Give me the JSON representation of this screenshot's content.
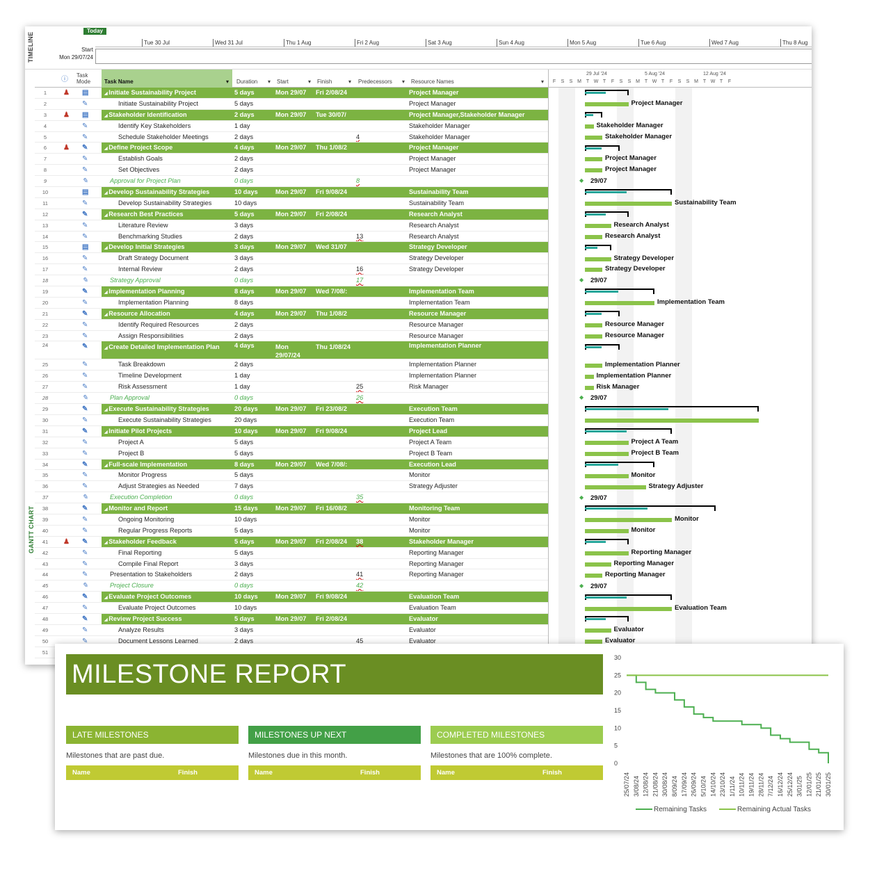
{
  "timeline": {
    "side_label": "TIMELINE",
    "today_label": "Today",
    "start_label": "Start",
    "start_date": "Mon 29/07/24",
    "ticks": [
      "Tue 30 Jul",
      "Wed 31 Jul",
      "Thu 1 Aug",
      "Fri 2 Aug",
      "Sat 3 Aug",
      "Sun 4 Aug",
      "Mon 5 Aug",
      "Tue 6 Aug",
      "Wed 7 Aug",
      "Thu 8 Aug"
    ]
  },
  "gantt": {
    "side_label": "GANTT CHART",
    "columns": {
      "task_mode": "Task Mode",
      "task_name": "Task Name",
      "duration": "Duration",
      "start": "Start",
      "finish": "Finish",
      "predecessors": "Predecessors",
      "resources": "Resource Names"
    },
    "chart_header": {
      "weeks": [
        "29 Jul '24",
        "5 Aug '24",
        "12 Aug '24"
      ],
      "days": [
        "F",
        "S",
        "S",
        "M",
        "T",
        "W",
        "T",
        "F",
        "S",
        "S",
        "M",
        "T",
        "W",
        "T",
        "F",
        "S",
        "S",
        "M",
        "T",
        "W",
        "T",
        "F"
      ]
    },
    "rows": [
      {
        "id": "1",
        "name": "Initiate Sustainability Project",
        "dur": "5 days",
        "start": "Mon 29/07",
        "finish": "Fri 2/08/24",
        "pred": "",
        "res": "Project Manager",
        "type": "sum",
        "person": true,
        "mode": "auto"
      },
      {
        "id": "2",
        "name": "Initiate Sustainability Project",
        "dur": "5 days",
        "start": "",
        "finish": "",
        "pred": "",
        "res": "Project Manager",
        "type": "task"
      },
      {
        "id": "3",
        "name": "Stakeholder Identification",
        "dur": "2 days",
        "start": "Mon 29/07",
        "finish": "Tue 30/07/",
        "pred": "",
        "res": "Project Manager,Stakeholder Manager",
        "type": "sum",
        "person": true,
        "mode": "auto"
      },
      {
        "id": "4",
        "name": "Identify Key Stakeholders",
        "dur": "1 day",
        "start": "",
        "finish": "",
        "pred": "",
        "res": "Stakeholder Manager",
        "type": "task"
      },
      {
        "id": "5",
        "name": "Schedule Stakeholder Meetings",
        "dur": "2 days",
        "start": "",
        "finish": "",
        "pred": "4",
        "res": "Stakeholder Manager",
        "type": "task"
      },
      {
        "id": "6",
        "name": "Define Project Scope",
        "dur": "4 days",
        "start": "Mon 29/07",
        "finish": "Thu 1/08/2",
        "pred": "",
        "res": "Project Manager",
        "type": "sum",
        "person": true
      },
      {
        "id": "7",
        "name": "Establish Goals",
        "dur": "2 days",
        "start": "",
        "finish": "",
        "pred": "",
        "res": "Project Manager",
        "type": "task"
      },
      {
        "id": "8",
        "name": "Set Objectives",
        "dur": "2 days",
        "start": "",
        "finish": "",
        "pred": "",
        "res": "Project Manager",
        "type": "task"
      },
      {
        "id": "9",
        "name": "Approval for Project Plan",
        "dur": "0 days",
        "start": "",
        "finish": "",
        "pred": "8",
        "res": "",
        "type": "ms"
      },
      {
        "id": "10",
        "name": "Develop Sustainability Strategies",
        "dur": "10 days",
        "start": "Mon 29/07",
        "finish": "Fri 9/08/24",
        "pred": "",
        "res": "Sustainability Team",
        "type": "sum",
        "mode": "auto"
      },
      {
        "id": "11",
        "name": "Develop Sustainability Strategies",
        "dur": "10 days",
        "start": "",
        "finish": "",
        "pred": "",
        "res": "Sustainability Team",
        "type": "task"
      },
      {
        "id": "12",
        "name": "Research Best Practices",
        "dur": "5 days",
        "start": "Mon 29/07",
        "finish": "Fri 2/08/24",
        "pred": "",
        "res": "Research Analyst",
        "type": "sum"
      },
      {
        "id": "13",
        "name": "Literature Review",
        "dur": "3 days",
        "start": "",
        "finish": "",
        "pred": "",
        "res": "Research Analyst",
        "type": "task"
      },
      {
        "id": "14",
        "name": "Benchmarking Studies",
        "dur": "2 days",
        "start": "",
        "finish": "",
        "pred": "13",
        "res": "Research Analyst",
        "type": "task"
      },
      {
        "id": "15",
        "name": "Develop Initial Strategies",
        "dur": "3 days",
        "start": "Mon 29/07",
        "finish": "Wed 31/07",
        "pred": "",
        "res": "Strategy Developer",
        "type": "sum",
        "mode": "auto"
      },
      {
        "id": "16",
        "name": "Draft Strategy Document",
        "dur": "3 days",
        "start": "",
        "finish": "",
        "pred": "",
        "res": "Strategy Developer",
        "type": "task"
      },
      {
        "id": "17",
        "name": "Internal Review",
        "dur": "2 days",
        "start": "",
        "finish": "",
        "pred": "16",
        "res": "Strategy Developer",
        "type": "task"
      },
      {
        "id": "18",
        "name": "Strategy Approval",
        "dur": "0 days",
        "start": "",
        "finish": "",
        "pred": "17",
        "res": "",
        "type": "ms"
      },
      {
        "id": "19",
        "name": "Implementation Planning",
        "dur": "8 days",
        "start": "Mon 29/07",
        "finish": "Wed 7/08/:",
        "pred": "",
        "res": "Implementation Team",
        "type": "sum"
      },
      {
        "id": "20",
        "name": "Implementation Planning",
        "dur": "8 days",
        "start": "",
        "finish": "",
        "pred": "",
        "res": "Implementation Team",
        "type": "task"
      },
      {
        "id": "21",
        "name": "Resource Allocation",
        "dur": "4 days",
        "start": "Mon 29/07",
        "finish": "Thu 1/08/2",
        "pred": "",
        "res": "Resource Manager",
        "type": "sum"
      },
      {
        "id": "22",
        "name": "Identify Required Resources",
        "dur": "2 days",
        "start": "",
        "finish": "",
        "pred": "",
        "res": "Resource Manager",
        "type": "task"
      },
      {
        "id": "23",
        "name": "Assign Responsibilities",
        "dur": "2 days",
        "start": "",
        "finish": "",
        "pred": "",
        "res": "Resource Manager",
        "type": "task"
      },
      {
        "id": "24",
        "name": "Create Detailed Implementation Plan",
        "dur": "4 days",
        "start": "Mon 29/07/24",
        "finish": "Thu 1/08/24",
        "pred": "",
        "res": "Implementation Planner",
        "type": "sum",
        "tall": true
      },
      {
        "id": "25",
        "name": "Task Breakdown",
        "dur": "2 days",
        "start": "",
        "finish": "",
        "pred": "",
        "res": "Implementation Planner",
        "type": "task"
      },
      {
        "id": "26",
        "name": "Timeline Development",
        "dur": "1 day",
        "start": "",
        "finish": "",
        "pred": "",
        "res": "Implementation Planner",
        "type": "task"
      },
      {
        "id": "27",
        "name": "Risk Assessment",
        "dur": "1 day",
        "start": "",
        "finish": "",
        "pred": "25",
        "res": "Risk Manager",
        "type": "task"
      },
      {
        "id": "28",
        "name": "Plan Approval",
        "dur": "0 days",
        "start": "",
        "finish": "",
        "pred": "26",
        "res": "",
        "type": "ms"
      },
      {
        "id": "29",
        "name": "Execute Sustainability Strategies",
        "dur": "20 days",
        "start": "Mon 29/07",
        "finish": "Fri 23/08/2",
        "pred": "",
        "res": "Execution Team",
        "type": "sum"
      },
      {
        "id": "30",
        "name": "Execute Sustainability Strategies",
        "dur": "20 days",
        "start": "",
        "finish": "",
        "pred": "",
        "res": "Execution Team",
        "type": "task"
      },
      {
        "id": "31",
        "name": "Initiate Pilot Projects",
        "dur": "10 days",
        "start": "Mon 29/07",
        "finish": "Fri 9/08/24",
        "pred": "",
        "res": "Project Lead",
        "type": "sum"
      },
      {
        "id": "32",
        "name": "Project A",
        "dur": "5 days",
        "start": "",
        "finish": "",
        "pred": "",
        "res": "Project A Team",
        "type": "task"
      },
      {
        "id": "33",
        "name": "Project B",
        "dur": "5 days",
        "start": "",
        "finish": "",
        "pred": "",
        "res": "Project B Team",
        "type": "task"
      },
      {
        "id": "34",
        "name": "Full-scale Implementation",
        "dur": "8 days",
        "start": "Mon 29/07",
        "finish": "Wed 7/08/:",
        "pred": "",
        "res": "Execution Lead",
        "type": "sum"
      },
      {
        "id": "35",
        "name": "Monitor Progress",
        "dur": "5 days",
        "start": "",
        "finish": "",
        "pred": "",
        "res": "Monitor",
        "type": "task"
      },
      {
        "id": "36",
        "name": "Adjust Strategies as Needed",
        "dur": "7 days",
        "start": "",
        "finish": "",
        "pred": "",
        "res": "Strategy Adjuster",
        "type": "task"
      },
      {
        "id": "37",
        "name": "Execution Completion",
        "dur": "0 days",
        "start": "",
        "finish": "",
        "pred": "35",
        "res": "",
        "type": "ms"
      },
      {
        "id": "38",
        "name": "Monitor and Report",
        "dur": "15 days",
        "start": "Mon 29/07",
        "finish": "Fri 16/08/2",
        "pred": "",
        "res": "Monitoring Team",
        "type": "sum"
      },
      {
        "id": "39",
        "name": "Ongoing Monitoring",
        "dur": "10 days",
        "start": "",
        "finish": "",
        "pred": "",
        "res": "Monitor",
        "type": "task"
      },
      {
        "id": "40",
        "name": "Regular Progress Reports",
        "dur": "5 days",
        "start": "",
        "finish": "",
        "pred": "",
        "res": "Monitor",
        "type": "task"
      },
      {
        "id": "41",
        "name": "Stakeholder Feedback",
        "dur": "5 days",
        "start": "Mon 29/07",
        "finish": "Fri 2/08/24",
        "pred": "38",
        "res": "Stakeholder Manager",
        "type": "sum",
        "person": true
      },
      {
        "id": "42",
        "name": "Final Reporting",
        "dur": "5 days",
        "start": "",
        "finish": "",
        "pred": "",
        "res": "Reporting Manager",
        "type": "task"
      },
      {
        "id": "43",
        "name": "Compile Final Report",
        "dur": "3 days",
        "start": "",
        "finish": "",
        "pred": "",
        "res": "Reporting Manager",
        "type": "task"
      },
      {
        "id": "44",
        "name": "Presentation to Stakeholders",
        "dur": "2 days",
        "start": "",
        "finish": "",
        "pred": "41",
        "res": "Reporting Manager",
        "type": "task0"
      },
      {
        "id": "45",
        "name": "Project Closure",
        "dur": "0 days",
        "start": "",
        "finish": "",
        "pred": "42",
        "res": "",
        "type": "ms"
      },
      {
        "id": "46",
        "name": "Evaluate Project Outcomes",
        "dur": "10 days",
        "start": "Mon 29/07",
        "finish": "Fri 9/08/24",
        "pred": "",
        "res": "Evaluation Team",
        "type": "sum"
      },
      {
        "id": "47",
        "name": "Evaluate Project Outcomes",
        "dur": "10 days",
        "start": "",
        "finish": "",
        "pred": "",
        "res": "Evaluation Team",
        "type": "task"
      },
      {
        "id": "48",
        "name": "Review Project Success",
        "dur": "5 days",
        "start": "Mon 29/07",
        "finish": "Fri 2/08/24",
        "pred": "",
        "res": "Evaluator",
        "type": "sum"
      },
      {
        "id": "49",
        "name": "Analyze Results",
        "dur": "3 days",
        "start": "",
        "finish": "",
        "pred": "",
        "res": "Evaluator",
        "type": "task"
      },
      {
        "id": "50",
        "name": "Document Lessons Learned",
        "dur": "2 days",
        "start": "",
        "finish": "",
        "pred": "45",
        "res": "Evaluator",
        "type": "task"
      },
      {
        "id": "51",
        "name": "",
        "dur": "",
        "start": "",
        "finish": "",
        "pred": "",
        "res": "",
        "type": "empty"
      }
    ],
    "bar_labels": {
      "2": "Project Manager",
      "4": "Stakeholder Manager",
      "5": "Stakeholder Manager",
      "7": "Project Manager",
      "8": "Project Manager",
      "9": "29/07",
      "11": "Sustainability Team",
      "13": "Research Analyst",
      "14": "Research Analyst",
      "16": "Strategy Developer",
      "17": "Strategy Developer",
      "18": "29/07",
      "20": "Implementation Team",
      "22": "Resource Manager",
      "23": "Resource Manager",
      "25": "Implementation Planner",
      "26": "Implementation Planner",
      "27": "Risk Manager",
      "28": "29/07",
      "32": "Project A Team",
      "33": "Project B Team",
      "35": "Monitor",
      "36": "Strategy Adjuster",
      "37": "29/07",
      "39": "Monitor",
      "40": "Monitor",
      "42": "Reporting Manager",
      "43": "Reporting Manager",
      "44": "Reporting Manager",
      "45": "29/07",
      "47": "Evaluation Team",
      "49": "Evaluator",
      "50": "Evaluator"
    }
  },
  "report": {
    "title": "MILESTONE REPORT",
    "sections": [
      {
        "heading": "LATE MILESTONES",
        "desc": "Milestones that are past due.",
        "col1": "Name",
        "col2": "Finish",
        "color": "#8bb432"
      },
      {
        "heading": "MILESTONES UP NEXT",
        "desc": "Milestones due in this month.",
        "col1": "Name",
        "col2": "Finish",
        "color": "#43a047"
      },
      {
        "heading": "COMPLETED MILESTONES",
        "desc": "Milestones that are 100% complete.",
        "col1": "Name",
        "col2": "Finish",
        "color": "#9ccc50"
      }
    ]
  },
  "chart_data": {
    "type": "line",
    "title": "",
    "xlabel": "",
    "ylabel": "",
    "ylim": [
      0,
      30
    ],
    "yticks": [
      0,
      5,
      10,
      15,
      20,
      25,
      30
    ],
    "categories": [
      "25/07/24",
      "3/08/24",
      "12/08/24",
      "21/08/24",
      "30/08/24",
      "8/09/24",
      "17/09/24",
      "26/09/24",
      "5/10/24",
      "14/10/24",
      "23/10/24",
      "1/11/24",
      "10/11/24",
      "19/11/24",
      "28/11/24",
      "7/12/24",
      "16/12/24",
      "25/12/24",
      "3/01/25",
      "12/01/25",
      "21/01/25",
      "30/01/25"
    ],
    "series": [
      {
        "name": "Remaining Tasks",
        "color": "#4caf50",
        "values": [
          25,
          23,
          21,
          20,
          20,
          18,
          16,
          14,
          13,
          12,
          12,
          12,
          11,
          11,
          10,
          8,
          7,
          6,
          6,
          4,
          3,
          0
        ]
      },
      {
        "name": "Remaining Actual Tasks",
        "color": "#8bc34a",
        "values": [
          25,
          25,
          25,
          25,
          25,
          25,
          25,
          25,
          25,
          25,
          25,
          25,
          25,
          25,
          25,
          25,
          25,
          25,
          25,
          25,
          25,
          25
        ]
      }
    ],
    "legend": "bottom",
    "grid": false
  },
  "colors": {
    "summary": "#7cb342",
    "bar": "#8bc34a",
    "teal": "#26a69a",
    "title_bg": "#6a8e23",
    "table_head": "#c0ca33"
  }
}
